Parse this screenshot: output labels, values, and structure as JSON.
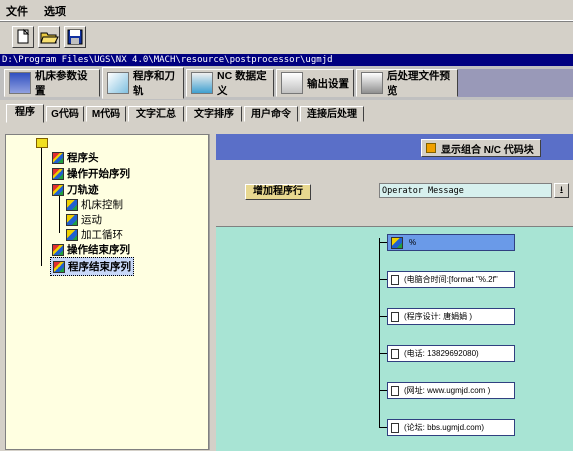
{
  "menu": [
    "文件",
    "选项"
  ],
  "toolbar": {
    "buttons": [
      "new-file-icon",
      "open-folder-icon",
      "save-icon"
    ]
  },
  "path": "D:\\Program Files\\UGS\\NX 4.0\\MACH\\resource\\postprocessor\\ugmjd",
  "main_tabs": [
    "机床参数设置",
    "程序和刀轨",
    "NC 数据定义",
    "输出设置",
    "后处理文件预览"
  ],
  "sub_tabs": [
    "程序",
    "G代码",
    "M代码",
    "文字汇总",
    "文字排序",
    "用户命令",
    "连接后处理"
  ],
  "tree": {
    "root_icon": "folder-icon",
    "nodes": [
      "程序头",
      "操作开始序列",
      "刀轨迹",
      "机床控制",
      "运动",
      "加工循环",
      "操作结束序列",
      "程序结束序列"
    ]
  },
  "display_button": "显示组合 N/C 代码块",
  "add_button": "增加程序行",
  "combo_value": "Operator Message",
  "blocks": [
    "%",
    "(电脑合时间:[format \"%.2f\"",
    "(程序设计: 唐娟娟    )",
    "(电话: 13829692080)",
    "(网址: www.ugmjd.com )",
    "(论坛: bbs.ugmjd.com)"
  ]
}
